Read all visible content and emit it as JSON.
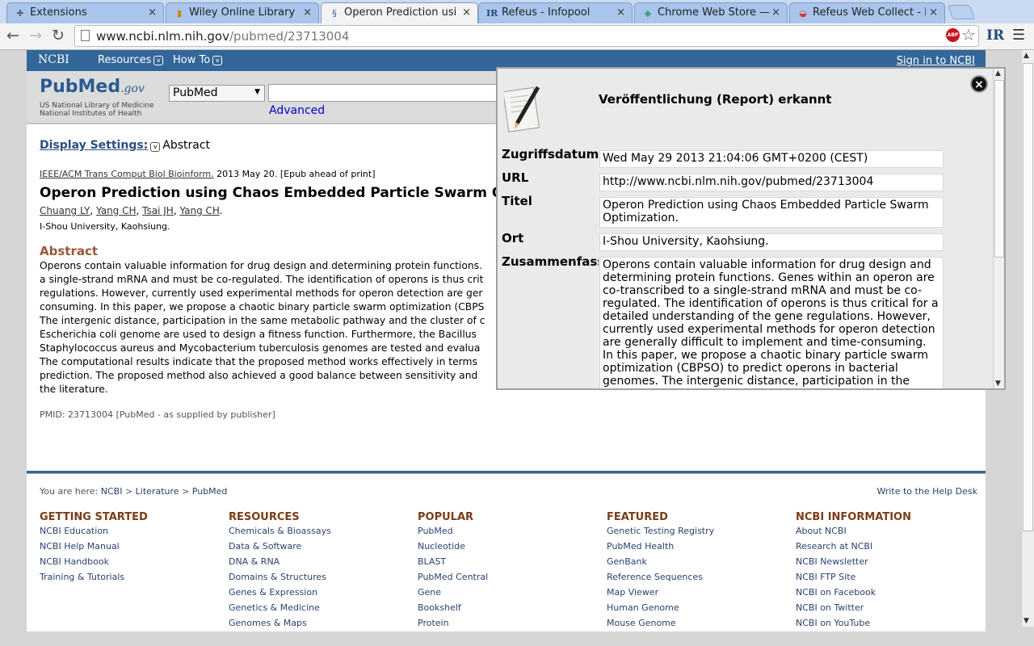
{
  "browser": {
    "tabs": [
      {
        "label": "Extensions",
        "icon": "puzzle-icon"
      },
      {
        "label": "Wiley Online Library",
        "icon": "books-icon"
      },
      {
        "label": "Operon Prediction usin",
        "icon": "ncbi-icon",
        "active": true
      },
      {
        "label": "Refeus - Infopool",
        "icon": "ir-icon"
      },
      {
        "label": "Chrome Web Store — C",
        "icon": "chrome-store-icon"
      },
      {
        "label": "Refeus Web Collect - E",
        "icon": "refeus-icon"
      }
    ],
    "url_host": "www.ncbi.nlm.nih.gov",
    "url_path": "/pubmed/23713004",
    "abp_label": "ABP",
    "ext_label": "IR"
  },
  "ncbi": {
    "logo": "NCBI",
    "resources": "Resources",
    "howto": "How To",
    "signin": "Sign in to NCBI",
    "pubmed_logo": "PubMed",
    "pubmed_gov": ".gov",
    "nlm": "US National Library of Medicine National Institutes of Health",
    "db_select": "PubMed",
    "search_value": "",
    "advanced": "Advanced"
  },
  "article": {
    "display_settings": "Display Settings:",
    "display_value": "Abstract",
    "journal": "IEEE/ACM Trans Comput Biol Bioinform.",
    "date": "2013 May 20. [Epub ahead of print]",
    "title": "Operon Prediction using Chaos Embedded Particle Swarm Optimization.",
    "authors": [
      "Chuang LY",
      "Yang CH",
      "Tsai JH",
      "Yang CH"
    ],
    "affiliation": "I-Shou University, Kaohsiung.",
    "abstract_heading": "Abstract",
    "abstract_lines": [
      "Operons contain valuable information for drug design and determining protein functions.",
      "a single-strand mRNA and must be co-regulated. The identification of operons is thus crit",
      "regulations. However, currently used experimental methods for operon detection are ger",
      "consuming. In this paper, we propose a chaotic binary particle swarm optimization (CBPS",
      "The intergenic distance, participation in the same metabolic pathway and the cluster of c",
      "Escherichia coli genome are used to design a fitness function. Furthermore, the Bacillus",
      "Staphylococcus aureus and Mycobacterium tuberculosis genomes are tested and evalua",
      "The computational results indicate that the proposed method works effectively in terms",
      "prediction. The proposed method also achieved a good balance between sensitivity and",
      "the literature."
    ],
    "pmid": "PMID: 23713004 [PubMed - as supplied by publisher]"
  },
  "footer": {
    "you_are_here": "You are here:",
    "crumbs": [
      "NCBI",
      "Literature",
      "PubMed"
    ],
    "sep": " > ",
    "help": "Write to the Help Desk",
    "columns": [
      {
        "heading": "GETTING STARTED",
        "items": [
          "NCBI Education",
          "NCBI Help Manual",
          "NCBI Handbook",
          "Training & Tutorials"
        ]
      },
      {
        "heading": "RESOURCES",
        "items": [
          "Chemicals & Bioassays",
          "Data & Software",
          "DNA & RNA",
          "Domains & Structures",
          "Genes & Expression",
          "Genetics & Medicine",
          "Genomes & Maps"
        ]
      },
      {
        "heading": "POPULAR",
        "items": [
          "PubMed",
          "Nucleotide",
          "BLAST",
          "PubMed Central",
          "Gene",
          "Bookshelf",
          "Protein"
        ]
      },
      {
        "heading": "FEATURED",
        "items": [
          "Genetic Testing Registry",
          "PubMed Health",
          "GenBank",
          "Reference Sequences",
          "Map Viewer",
          "Human Genome",
          "Mouse Genome"
        ]
      },
      {
        "heading": "NCBI INFORMATION",
        "items": [
          "About NCBI",
          "Research at NCBI",
          "NCBI Newsletter",
          "NCBI FTP Site",
          "NCBI on Facebook",
          "NCBI on Twitter",
          "NCBI on YouTube"
        ]
      }
    ]
  },
  "popup": {
    "title": "Veröffentlichung (Report) erkannt",
    "close": "×",
    "fields": [
      {
        "label": "Zugriffsdatum",
        "value": "Wed May 29 2013 21:04:06 GMT+0200 (CEST)"
      },
      {
        "label": "URL",
        "value": "http://www.ncbi.nlm.nih.gov/pubmed/23713004"
      },
      {
        "label": "Titel",
        "value": "Operon Prediction using Chaos Embedded Particle Swarm Optimization."
      },
      {
        "label": "Ort",
        "value": "I-Shou University, Kaohsiung."
      },
      {
        "label": "Zusammenfass",
        "value": "Operons contain valuable information for drug design and determining protein functions. Genes within an operon are co-transcribed to a single-strand mRNA and must be co-regulated. The identification of operons is thus critical for a detailed understanding of the gene regulations. However, currently used experimental methods for operon detection are generally difficult to implement and time-consuming. In this paper, we propose a chaotic binary particle swarm optimization (CBPSO) to predict operons in bacterial genomes. The intergenic distance, participation in the same"
      }
    ]
  },
  "colors": {
    "ncbi_blue": "#336699",
    "heading_brown": "#985735",
    "popup_bg": "#e9ebea"
  }
}
